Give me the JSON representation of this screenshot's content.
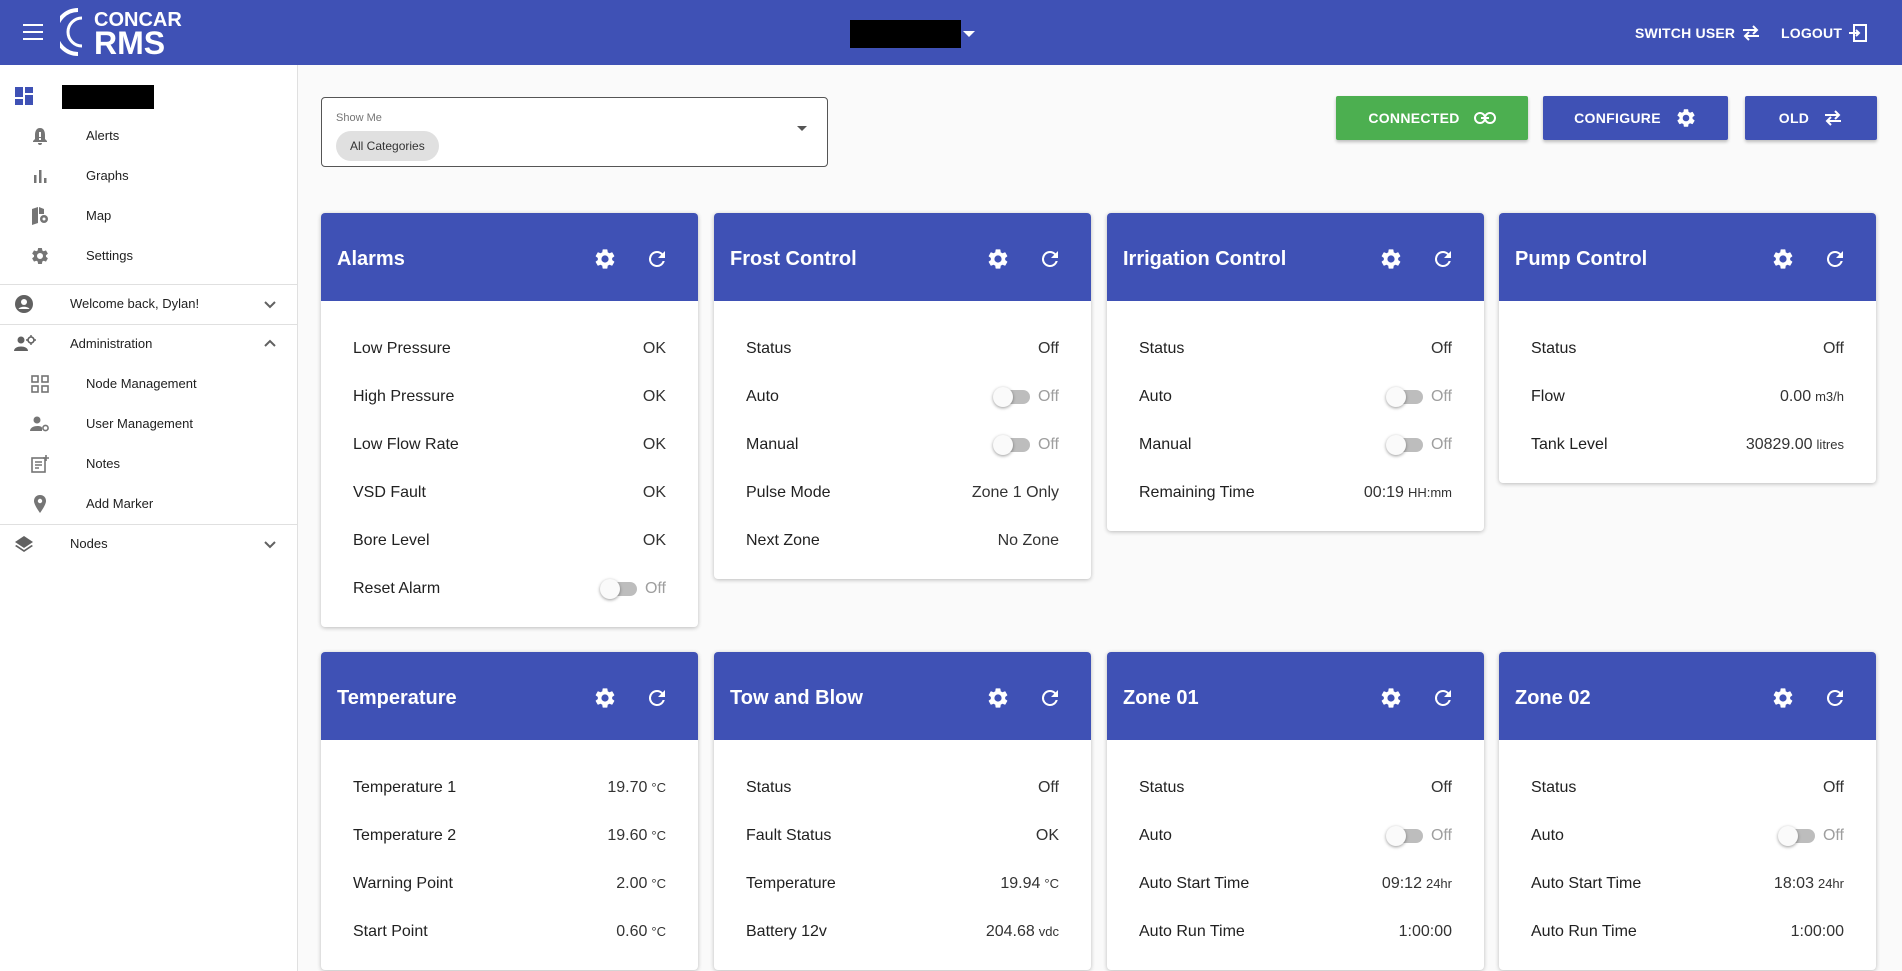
{
  "header": {
    "logo_top": "CONCAR",
    "logo_bottom": "RMS",
    "switch_user": "SWITCH USER",
    "logout": "LOGOUT"
  },
  "sidebar": {
    "items": [
      {
        "label": "Alerts",
        "icon": "bell-alert-icon"
      },
      {
        "label": "Graphs",
        "icon": "bar-chart-icon"
      },
      {
        "label": "Map",
        "icon": "map-icon"
      },
      {
        "label": "Settings",
        "icon": "gear-icon"
      }
    ],
    "welcome": "Welcome back, Dylan!",
    "administration": "Administration",
    "admin_items": [
      {
        "label": "Node Management",
        "icon": "grid-icon"
      },
      {
        "label": "User Management",
        "icon": "user-gear-icon"
      },
      {
        "label": "Notes",
        "icon": "notes-icon"
      },
      {
        "label": "Add Marker",
        "icon": "pin-icon"
      }
    ],
    "nodes": "Nodes"
  },
  "filter": {
    "label": "Show Me",
    "chip": "All Categories"
  },
  "buttons": {
    "connected": "CONNECTED",
    "configure": "CONFIGURE",
    "old": "OLD"
  },
  "colors": {
    "primary": "#3f51b5",
    "success": "#4caf50"
  },
  "cards": [
    {
      "title": "Alarms",
      "rows": [
        {
          "label": "Low Pressure",
          "value": "OK"
        },
        {
          "label": "High Pressure",
          "value": "OK"
        },
        {
          "label": "Low Flow Rate",
          "value": "OK"
        },
        {
          "label": "VSD Fault",
          "value": "OK"
        },
        {
          "label": "Bore Level",
          "value": "OK"
        },
        {
          "label": "Reset Alarm",
          "value": "Off"
        }
      ]
    },
    {
      "title": "Frost Control",
      "rows": [
        {
          "label": "Status",
          "value": "Off"
        },
        {
          "label": "Auto",
          "value": "Off"
        },
        {
          "label": "Manual",
          "value": "Off"
        },
        {
          "label": "Pulse Mode",
          "value": "Zone 1 Only"
        },
        {
          "label": "Next Zone",
          "value": "No Zone"
        }
      ]
    },
    {
      "title": "Irrigation Control",
      "rows": [
        {
          "label": "Status",
          "value": "Off"
        },
        {
          "label": "Auto",
          "value": "Off"
        },
        {
          "label": "Manual",
          "value": "Off"
        },
        {
          "label": "Remaining Time",
          "value": "00:19",
          "unit": "HH:mm"
        }
      ]
    },
    {
      "title": "Pump Control",
      "rows": [
        {
          "label": "Status",
          "value": "Off"
        },
        {
          "label": "Flow",
          "value": "0.00",
          "unit": "m3/h"
        },
        {
          "label": "Tank Level",
          "value": "30829.00",
          "unit": "litres"
        }
      ]
    },
    {
      "title": "Temperature",
      "rows": [
        {
          "label": "Temperature 1",
          "value": "19.70",
          "unit": "°C"
        },
        {
          "label": "Temperature 2",
          "value": "19.60",
          "unit": "°C"
        },
        {
          "label": "Warning Point",
          "value": "2.00",
          "unit": "°C"
        },
        {
          "label": "Start Point",
          "value": "0.60",
          "unit": "°C"
        }
      ]
    },
    {
      "title": "Tow and Blow",
      "rows": [
        {
          "label": "Status",
          "value": "Off"
        },
        {
          "label": "Fault Status",
          "value": "OK"
        },
        {
          "label": "Temperature",
          "value": "19.94",
          "unit": "°C"
        },
        {
          "label": "Battery 12v",
          "value": "204.68",
          "unit": "vdc"
        }
      ]
    },
    {
      "title": "Zone 01",
      "rows": [
        {
          "label": "Status",
          "value": "Off"
        },
        {
          "label": "Auto",
          "value": "Off"
        },
        {
          "label": "Auto Start Time",
          "value": "09:12",
          "unit": "24hr"
        },
        {
          "label": "Auto Run Time",
          "value": "1:00:00"
        }
      ]
    },
    {
      "title": "Zone 02",
      "rows": [
        {
          "label": "Status",
          "value": "Off"
        },
        {
          "label": "Auto",
          "value": "Off"
        },
        {
          "label": "Auto Start Time",
          "value": "18:03",
          "unit": "24hr"
        },
        {
          "label": "Auto Run Time",
          "value": "1:00:00"
        }
      ]
    }
  ]
}
